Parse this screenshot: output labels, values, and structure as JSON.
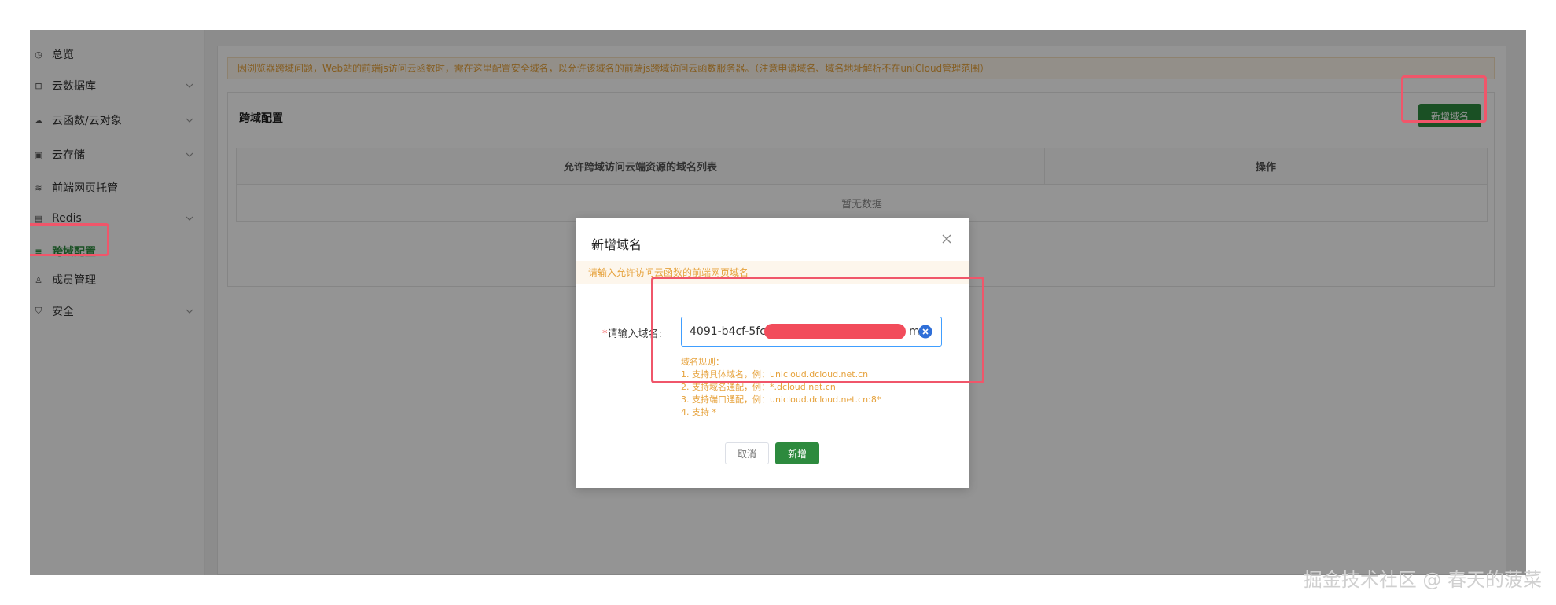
{
  "sidebar": {
    "items": [
      {
        "label": "总览",
        "icon": "clock-icon"
      },
      {
        "label": "云数据库",
        "icon": "database-icon"
      },
      {
        "label": "云函数/云对象",
        "icon": "cloud-icon"
      },
      {
        "label": "云存储",
        "icon": "storage-icon"
      },
      {
        "label": "前端网页托管",
        "icon": "web-hosting-icon"
      },
      {
        "label": "Redis",
        "icon": "redis-icon"
      },
      {
        "label": "跨域配置",
        "icon": "cors-icon"
      },
      {
        "label": "成员管理",
        "icon": "user-icon"
      },
      {
        "label": "安全",
        "icon": "shield-icon"
      }
    ]
  },
  "main": {
    "tip": "因浏览器跨域问题，Web站的前端js访问云函数时，需在这里配置安全域名，以允许该域名的前端js跨域访问云函数服务器。（注意申请域名、域名地址解析不在uniCloud管理范围）",
    "card_title": "跨域配置",
    "add_button": "新增域名",
    "table": {
      "col_domains": "允许跨域访问云端资源的域名列表",
      "col_actions": "操作",
      "empty": "暂无数据"
    }
  },
  "dialog": {
    "title": "新增域名",
    "tip": "请输入允许访问云函数的前端网页域名",
    "field_required": "*",
    "field_label": "请输入域名:",
    "field_value": "4091-b4cf-5fc",
    "field_value_suffix": "m",
    "rules": {
      "heading": "域名规则：",
      "r1": "1. 支持具体域名，例：unicloud.dcloud.net.cn",
      "r2": "2. 支持域名通配，例：*.dcloud.net.cn",
      "r3": "3. 支持端口通配，例：unicloud.dcloud.net.cn:8*",
      "r4": "4. 支持 *"
    },
    "cancel": "取消",
    "confirm": "新增"
  },
  "watermark": "掘金技术社区 @ 春天的菠菜",
  "colors": {
    "primary": "#2d8a3e",
    "warning_text": "#e6a23c",
    "highlight": "#f0566a",
    "focus": "#409eff"
  }
}
